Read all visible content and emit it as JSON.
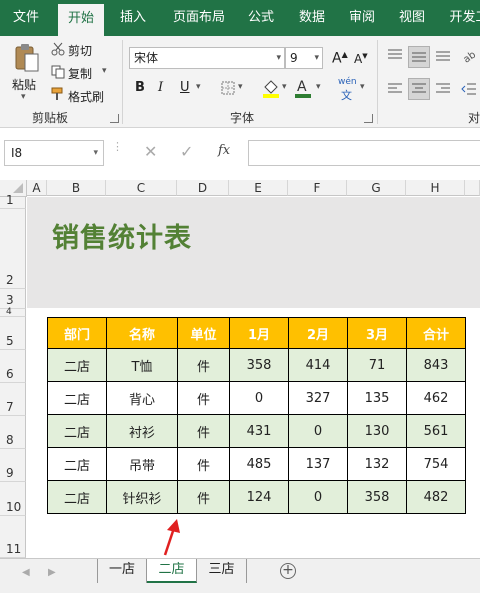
{
  "tabs": [
    {
      "label": "文件",
      "active": false
    },
    {
      "label": "开始",
      "active": true
    },
    {
      "label": "插入",
      "active": false
    },
    {
      "label": "页面布局",
      "active": false
    },
    {
      "label": "公式",
      "active": false
    },
    {
      "label": "数据",
      "active": false
    },
    {
      "label": "审阅",
      "active": false
    },
    {
      "label": "视图",
      "active": false
    },
    {
      "label": "开发工",
      "active": false
    }
  ],
  "ribbon": {
    "clipboard": {
      "paste": "粘贴",
      "cut": "剪切",
      "copy": "复制",
      "format_painter": "格式刷",
      "group": "剪贴板"
    },
    "font": {
      "name": "宋体",
      "size": "9",
      "bold": "B",
      "italic": "I",
      "underline": "U",
      "phonetic": "wén",
      "group": "字体"
    },
    "alignment": {
      "group": "对"
    }
  },
  "formula_bar": {
    "cell_ref": "I8",
    "fx": "fx",
    "value": ""
  },
  "columns": [
    "A",
    "B",
    "C",
    "D",
    "E",
    "F",
    "G",
    "H"
  ],
  "rows": [
    "1",
    "2",
    "3",
    "4",
    "5",
    "6",
    "7",
    "8",
    "9",
    "10",
    "11"
  ],
  "sheet_title": "销售统计表",
  "table": {
    "headers": [
      "部门",
      "名称",
      "单位",
      "1月",
      "2月",
      "3月",
      "合计"
    ],
    "rows": [
      [
        "二店",
        "T恤",
        "件",
        "358",
        "414",
        "71",
        "843"
      ],
      [
        "二店",
        "背心",
        "件",
        "0",
        "327",
        "135",
        "462"
      ],
      [
        "二店",
        "衬衫",
        "件",
        "431",
        "0",
        "130",
        "561"
      ],
      [
        "二店",
        "吊带",
        "件",
        "485",
        "137",
        "132",
        "754"
      ],
      [
        "二店",
        "针织衫",
        "件",
        "124",
        "0",
        "358",
        "482"
      ]
    ]
  },
  "sheets": [
    {
      "label": "一店",
      "active": false
    },
    {
      "label": "二店",
      "active": true
    },
    {
      "label": "三店",
      "active": false
    }
  ],
  "colors": {
    "excel_green": "#217346",
    "header_fill": "#ffc000",
    "band_fill": "#e2efda",
    "title_color": "#538135",
    "arrow": "#e02020"
  }
}
